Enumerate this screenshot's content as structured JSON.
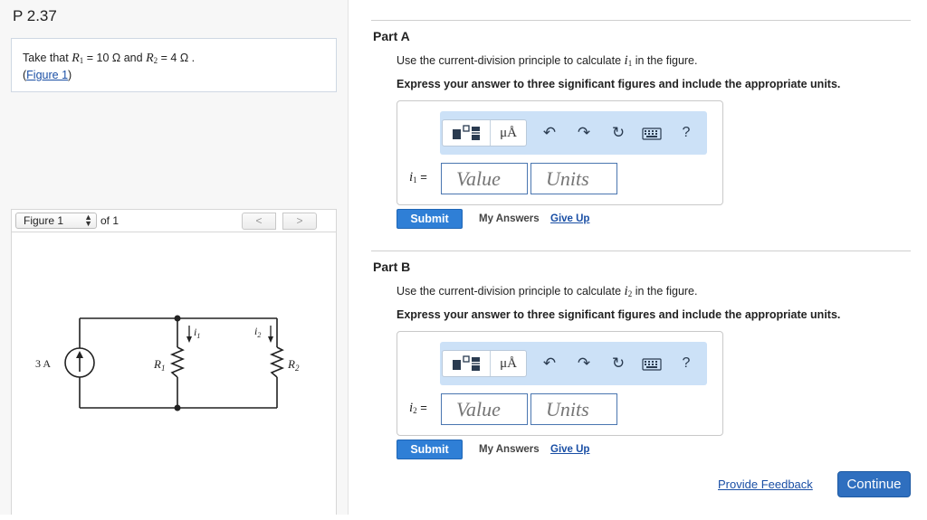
{
  "problem": {
    "title": "P 2.37",
    "given": {
      "prefix": "Take that",
      "r1_sym": "R",
      "r1_sub": "1",
      "r1_val": "= 10 Ω and",
      "r2_sym": "R",
      "r2_sub": "2",
      "r2_val": "= 4 Ω .",
      "figure_link_open": "(",
      "figure_link": "Figure 1",
      "figure_link_close": ")"
    }
  },
  "figure_nav": {
    "selected": "Figure 1",
    "of_label": "of 1",
    "prev_icon": "chevron-left-icon",
    "next_icon": "chevron-right-icon"
  },
  "figure": {
    "source_label": "3 A",
    "r1_label": "R",
    "r1_sub": "1",
    "r2_label": "R",
    "r2_sub": "2",
    "i1_label": "i",
    "i1_sub": "1",
    "i2_label": "i",
    "i2_sub": "2"
  },
  "parts": [
    {
      "title": "Part A",
      "prompt_pre": "Use the current-division principle to calculate",
      "var_sym": "i",
      "var_sub": "1",
      "prompt_post": "in the figure.",
      "instructions": "Express your answer to three significant figures and include the appropriate units.",
      "eq_sym": "i",
      "eq_sub": "1",
      "eq_sign": "=",
      "value_placeholder": "Value",
      "units_placeholder": "Units",
      "submit": "Submit",
      "my_answers": "My Answers",
      "give_up": "Give Up"
    },
    {
      "title": "Part B",
      "prompt_pre": "Use the current-division principle to calculate",
      "var_sym": "i",
      "var_sub": "2",
      "prompt_post": "in the figure.",
      "instructions": "Express your answer to three significant figures and include the appropriate units.",
      "eq_sym": "i",
      "eq_sub": "2",
      "eq_sign": "=",
      "value_placeholder": "Value",
      "units_placeholder": "Units",
      "submit": "Submit",
      "my_answers": "My Answers",
      "give_up": "Give Up"
    }
  ],
  "toolbar": {
    "units_btn": "μÅ",
    "help_btn": "?",
    "icons": [
      "templates-icon",
      "units-icon",
      "undo-icon",
      "redo-icon",
      "reset-icon",
      "keyboard-icon",
      "help-icon"
    ]
  },
  "footer": {
    "feedback": "Provide Feedback",
    "continue": "Continue"
  },
  "colors": {
    "accent": "#2f7fd6",
    "toolbar_bg": "#cce1f7",
    "link": "#1a4fa5"
  }
}
